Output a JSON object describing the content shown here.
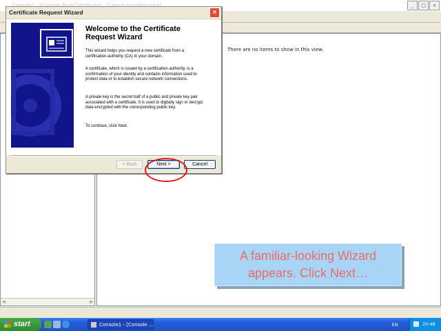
{
  "console": {
    "title": "Console1 - [Console Root\\Certificates - Current User\\Personal]",
    "window_buttons": [
      "_",
      "□",
      "×"
    ],
    "empty_message": "There are no items to show in this view.",
    "scroll_left": "<",
    "scroll_right": ">"
  },
  "dialog": {
    "title": "Certificate Request Wizard",
    "close_label": "×",
    "heading": "Welcome to the Certificate Request Wizard",
    "paragraphs": [
      "This wizard helps you request a new certificate from a certification authority (CA) in your domain.",
      "A certificate, which is issued by a certification authority, is a confirmation of your identity and contains information used to protect data or to establish secure network connections.",
      "A private key is the secret half of a public and private key pair associated with a certificate.  It is used to digitally sign or decrypt data encrypted with the corresponding public key.",
      "To continue, click Next."
    ],
    "back_label": "< Back",
    "next_label": "Next >",
    "cancel_label": "Cancel"
  },
  "callout": {
    "line1": "A familiar-looking Wizard",
    "line2": "appears. Click Next…"
  },
  "taskbar": {
    "start_label": "start",
    "task_label": "Console1 - [Console ...",
    "language": "EN",
    "clock": "20:48"
  },
  "colors": {
    "highlight_ring": "#e01818",
    "callout_bg": "#a8d4f6",
    "callout_text": "#ee6b6b",
    "banner": "#11148a",
    "taskbar": "#245edb",
    "start_button": "#2f8a2f"
  }
}
